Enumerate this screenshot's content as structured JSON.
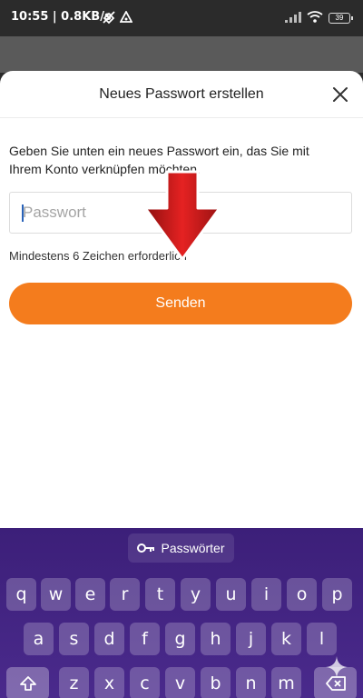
{
  "status_bar": {
    "time": "10:55 | 0.8KB/s",
    "battery": "39"
  },
  "dialog": {
    "title": "Neues Passwort erstellen",
    "description_line1": "Geben Sie unten ein neues Passwort ein, das Sie mit",
    "description_line2": "Ihrem Konto verknüpfen möchten.",
    "password_placeholder": "Passwort",
    "hint": "Mindestens 6 Zeichen erforderlich",
    "submit_label": "Senden"
  },
  "keyboard": {
    "suggestion_label": "Passwörter",
    "row1": [
      "q",
      "w",
      "e",
      "r",
      "t",
      "y",
      "u",
      "i",
      "o",
      "p"
    ],
    "row2": [
      "a",
      "s",
      "d",
      "f",
      "g",
      "h",
      "j",
      "k",
      "l"
    ],
    "row3": [
      "z",
      "x",
      "c",
      "v",
      "b",
      "n",
      "m"
    ]
  },
  "colors": {
    "accent": "#f47c1d",
    "keyboard_bg": "#3c1f79",
    "arrow": "#d11a1a"
  },
  "icons": [
    "slashed-signal-icon",
    "nav-triangle-icon",
    "cell-signal-icon",
    "wifi-icon",
    "battery-icon",
    "close-icon",
    "key-icon",
    "shift-icon",
    "backspace-icon",
    "sparkle-icon",
    "down-arrow-annotation"
  ]
}
